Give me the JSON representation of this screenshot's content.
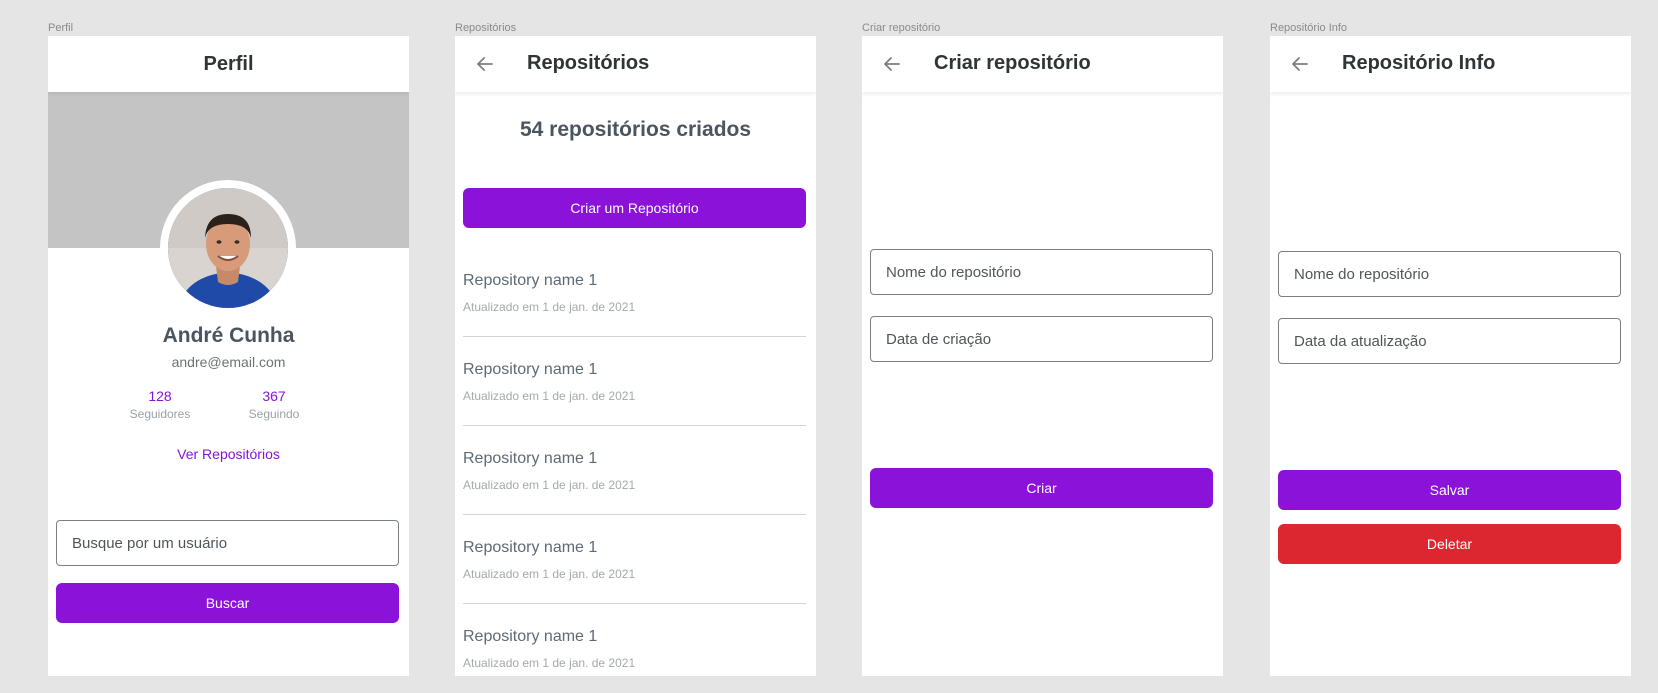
{
  "colors": {
    "accent": "#8A12D9",
    "danger": "#DC2730",
    "canvas": "#E5E5E5"
  },
  "frames": {
    "perfil": {
      "label": "Perfil",
      "title": "Perfil",
      "name": "André Cunha",
      "email": "andre@email.com",
      "followers": {
        "count": "128",
        "label": "Seguidores"
      },
      "following": {
        "count": "367",
        "label": "Seguindo"
      },
      "view_repos": "Ver Repositórios",
      "search_placeholder": "Busque por um usuário",
      "search_button": "Buscar"
    },
    "repositorios": {
      "label": "Repositórios",
      "title": "Repositórios",
      "count_text": "54 repositórios criados",
      "create_button": "Criar um Repositório",
      "items": [
        {
          "name": "Repository name 1",
          "date": "Atualizado em 1 de jan. de 2021"
        },
        {
          "name": "Repository name 1",
          "date": "Atualizado em 1 de jan. de 2021"
        },
        {
          "name": "Repository name 1",
          "date": "Atualizado em 1 de jan. de 2021"
        },
        {
          "name": "Repository name 1",
          "date": "Atualizado em 1 de jan. de 2021"
        },
        {
          "name": "Repository name 1",
          "date": "Atualizado em 1 de jan. de 2021"
        }
      ]
    },
    "criar": {
      "label": "Criar repositório",
      "title": "Criar repositório",
      "name_placeholder": "Nome do repositório",
      "date_placeholder": "Data de criação",
      "submit": "Criar"
    },
    "info": {
      "label": "Repositório Info",
      "title": "Repositório Info",
      "name_placeholder": "Nome do repositório",
      "date_placeholder": "Data da atualização",
      "save": "Salvar",
      "delete": "Deletar"
    }
  },
  "icons": {
    "back": "arrow-left-icon"
  }
}
